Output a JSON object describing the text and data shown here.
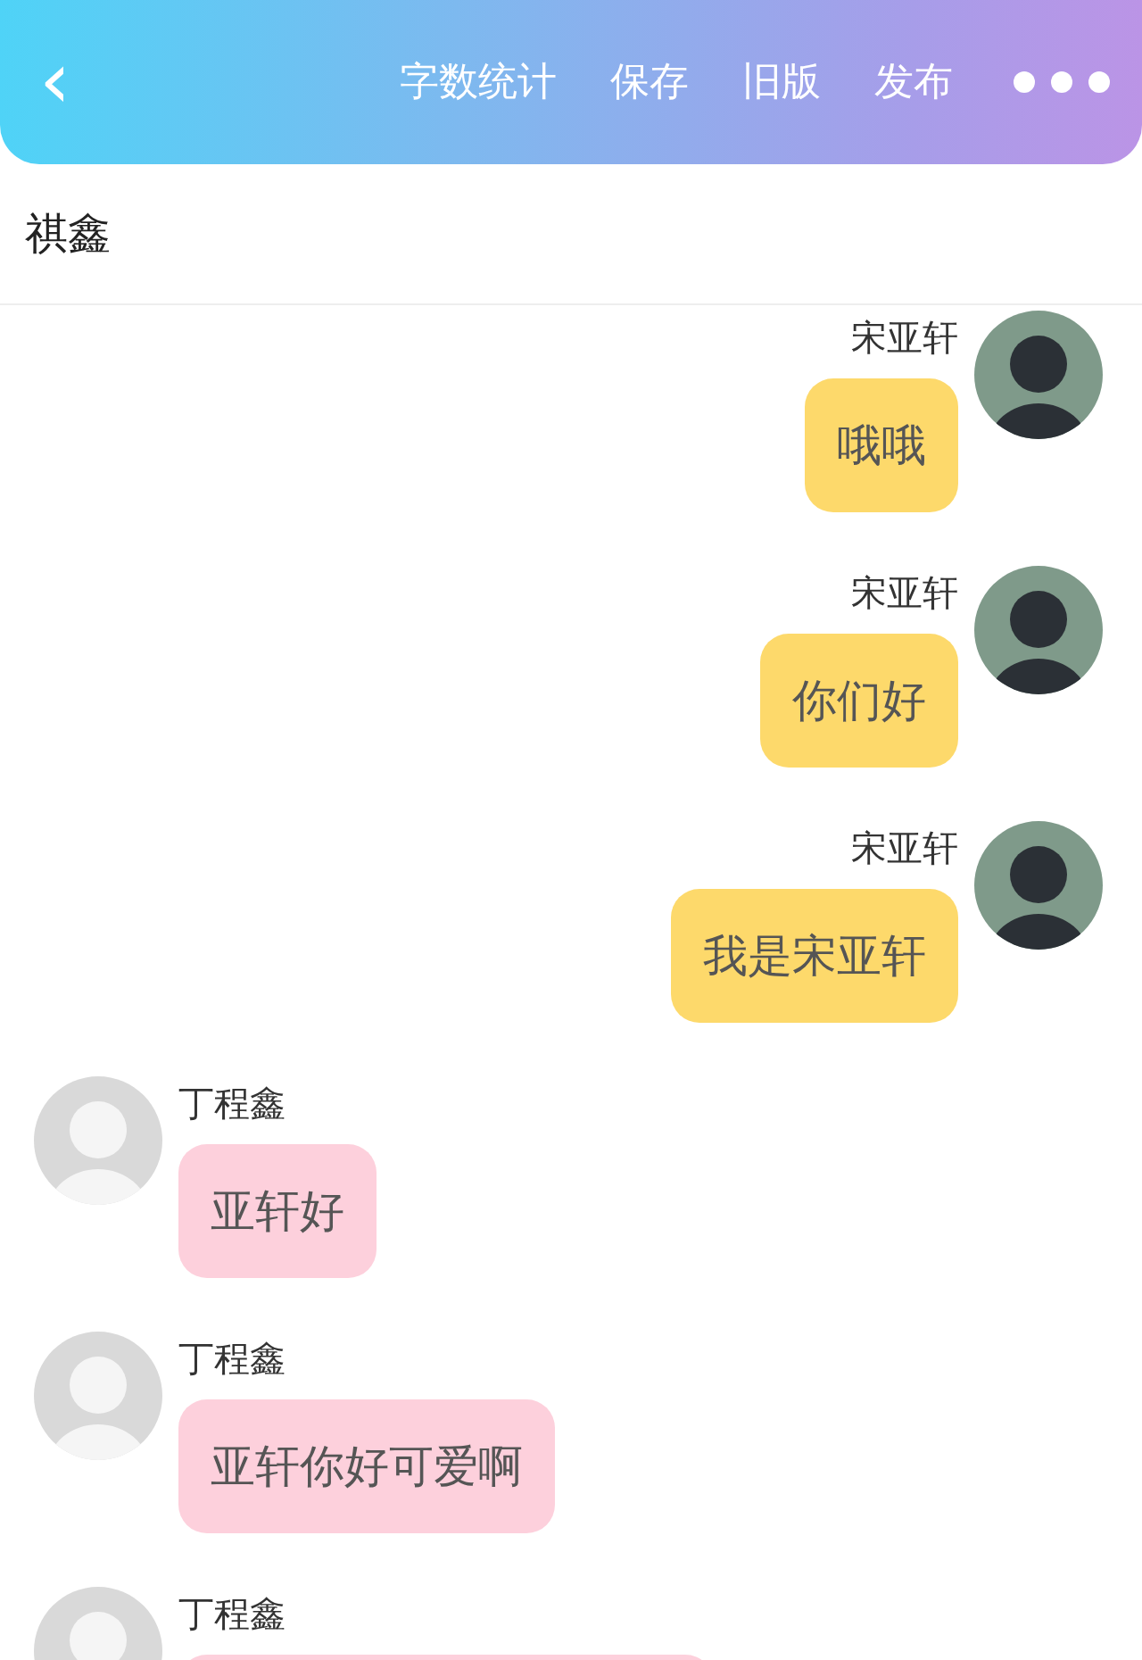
{
  "top_bar": {
    "back": "‹",
    "actions": [
      "字数统计",
      "保存",
      "旧版",
      "发布"
    ]
  },
  "title": "祺鑫",
  "messages": [
    {
      "kind": "sent",
      "sender": "宋亚轩",
      "text": "哦哦"
    },
    {
      "kind": "sent",
      "sender": "宋亚轩",
      "text": "你们好"
    },
    {
      "kind": "sent",
      "sender": "宋亚轩",
      "text": "我是宋亚轩"
    },
    {
      "kind": "received",
      "sender": "丁程鑫",
      "text": "亚轩好"
    },
    {
      "kind": "received",
      "sender": "丁程鑫",
      "text": "亚轩你好可爱啊"
    },
    {
      "kind": "received",
      "sender": "丁程鑫"
    }
  ]
}
